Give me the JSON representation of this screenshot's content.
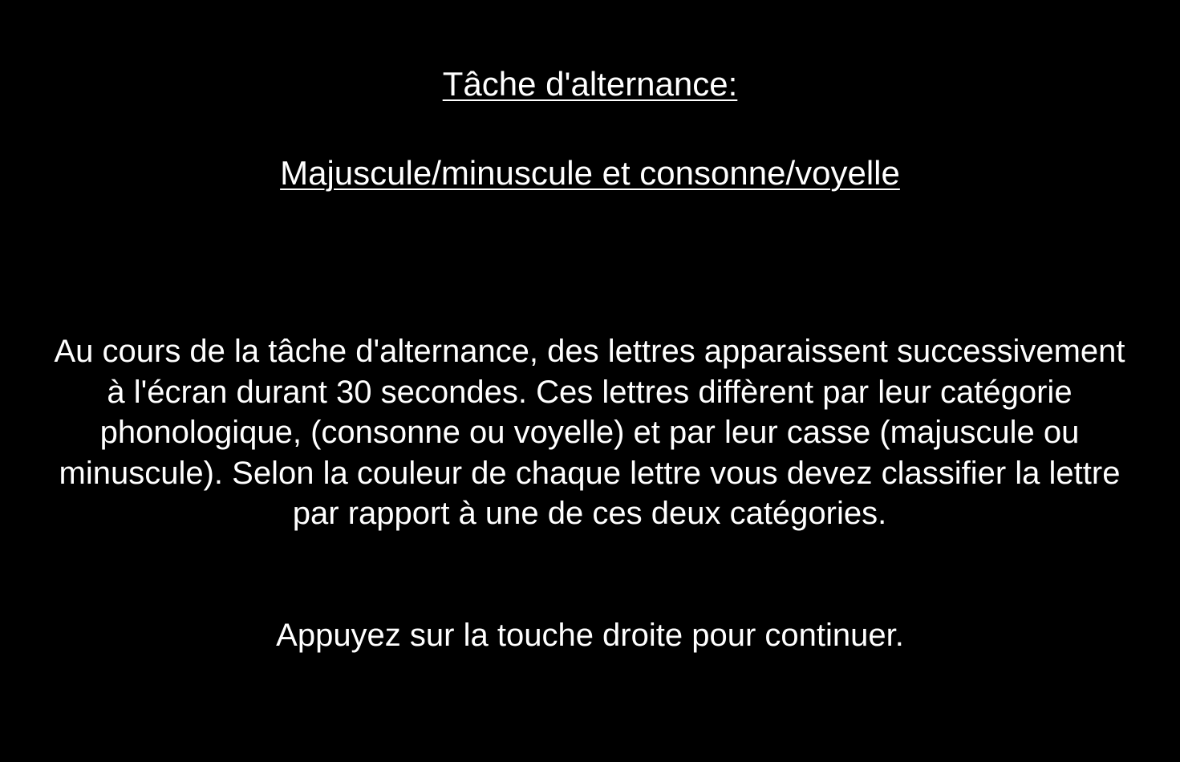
{
  "screen": {
    "background_color": "#000000",
    "text_color": "#ffffff",
    "title_line_1": "Tâche d'alternance:",
    "title_line_2": "Majuscule/minuscule et consonne/voyelle",
    "instructions": "Au cours de la tâche d'alternance, des lettres apparaissent successivement à l'écran durant 30 secondes. Ces lettres diffèrent par leur catégorie phonologique, (consonne ou voyelle) et par leur casse (majuscule ou minuscule). Selon la couleur de chaque lettre vous devez classifier la lettre par rapport à une de ces deux catégories.",
    "continue_prompt": "Appuyez sur la touche droite pour continuer."
  }
}
